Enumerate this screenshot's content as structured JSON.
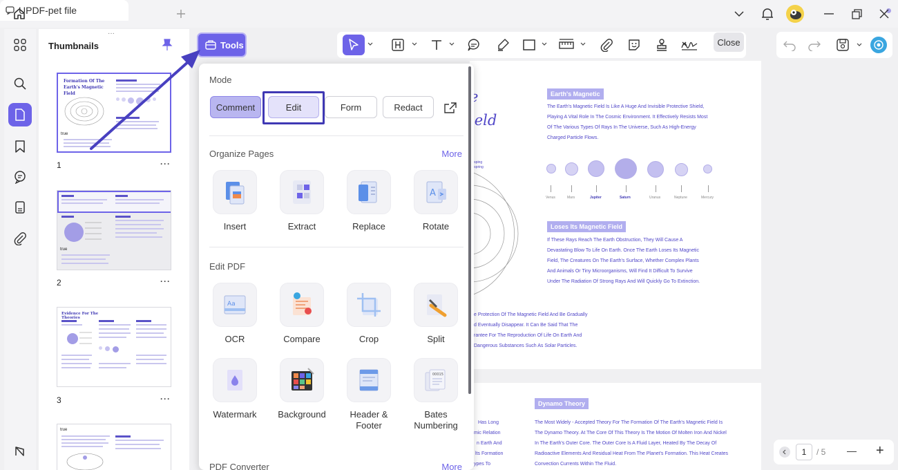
{
  "window": {
    "file_tab_title": "UPDF-pet file"
  },
  "thumbnails": {
    "title": "Thumbnails",
    "pages": [
      {
        "number": "1",
        "heading": "Formation Of The Earth's Magnetic Field",
        "label": "true",
        "selected": true
      },
      {
        "number": "2",
        "label": "true",
        "selected": false
      },
      {
        "number": "3",
        "heading": "Evidence For The Theories",
        "selected": false
      },
      {
        "number": "",
        "label": "true",
        "selected": false
      }
    ],
    "more_glyph": "···"
  },
  "toolbar": {
    "tools_label": "Tools",
    "close_label": "Close"
  },
  "tools_popup": {
    "mode": {
      "title": "Mode",
      "buttons": [
        "Comment",
        "Edit",
        "Form",
        "Redact"
      ],
      "active": "Comment",
      "highlighted": "Edit"
    },
    "organize": {
      "title": "Organize Pages",
      "more": "More",
      "items": [
        "Insert",
        "Extract",
        "Replace",
        "Rotate"
      ]
    },
    "edit_pdf": {
      "title": "Edit PDF",
      "items": [
        "OCR",
        "Compare",
        "Crop",
        "Split",
        "Watermark",
        "Background",
        "Header & Footer",
        "Bates Numbering"
      ]
    },
    "converter": {
      "title": "PDF Converter",
      "more": "More"
    }
  },
  "document": {
    "page1": {
      "big_lines": [
        "e",
        "ield"
      ],
      "section1_heading": "Earth's Magnetic",
      "section1_lines": [
        "The Earth's Magnetic Field Is Like A Huge And Invisible Protective Shield,",
        "Playing A Vital Role In The Cosmic Environment. It Effectively Resists Most",
        "Of The Various Types Of Rays In The Universe, Such As High-Energy",
        "Charged Particle Flows."
      ],
      "diagram_label": "g sping\nn spring",
      "planets": [
        "Venus",
        "Mars",
        "Jupiter",
        "Saturn",
        "Uranus",
        "Neptune",
        "Mercury"
      ],
      "section2_heading": "Loses Its Magnetic Field",
      "section2_lines": [
        "If These Rays Reach The Earth Obstruction, They Will Cause A",
        "Devastating Blow To Life On Earth. Once The Earth Loses Its Magnetic",
        "Field, The Creatures On The Earth's Surface, Whether Complex Plants",
        "And Animals Or Tiny Microorganisms, Will Find It Difficult To Survive",
        "Under The Radiation Of Strong Rays And Will Quickly Go To Extinction."
      ],
      "bottom_lines": [
        "e Protection Of The Magnetic Field And Be Gradually",
        "d Eventually Disappear. It Can Be Said That The",
        "rantee For The Reproduction Of Life On Earth And",
        "Dangerous Substances Such As Solar Particles."
      ]
    },
    "page2": {
      "heading": "Dynamo Theory",
      "left_lines": [
        "Has Long",
        "mic Relation",
        "n Earth And",
        "lts Formation",
        "ypes To"
      ],
      "right_lines": [
        "The Most Widely - Accepted Theory For The Formation Of The Earth's Magnetic Field Is",
        "The Dynamo Theory. At The Core Of This Theory Is The Motion Of Molten Iron And Nickel",
        "In The Earth's Outer Core. The Outer Core Is A Fluid Layer, Heated By The Decay Of",
        "Radioactive Elements And Residual Heat From The Planet's Formation. This Heat Creates",
        "Convection Currents Within The Fluid."
      ]
    }
  },
  "pager": {
    "current": "1",
    "total": "/ 5",
    "zoom_out": "—",
    "zoom_in": "+"
  },
  "colors": {
    "accent": "#6d63e8",
    "highlight_box": "#3f38b4",
    "doc_text": "#5046c8"
  }
}
